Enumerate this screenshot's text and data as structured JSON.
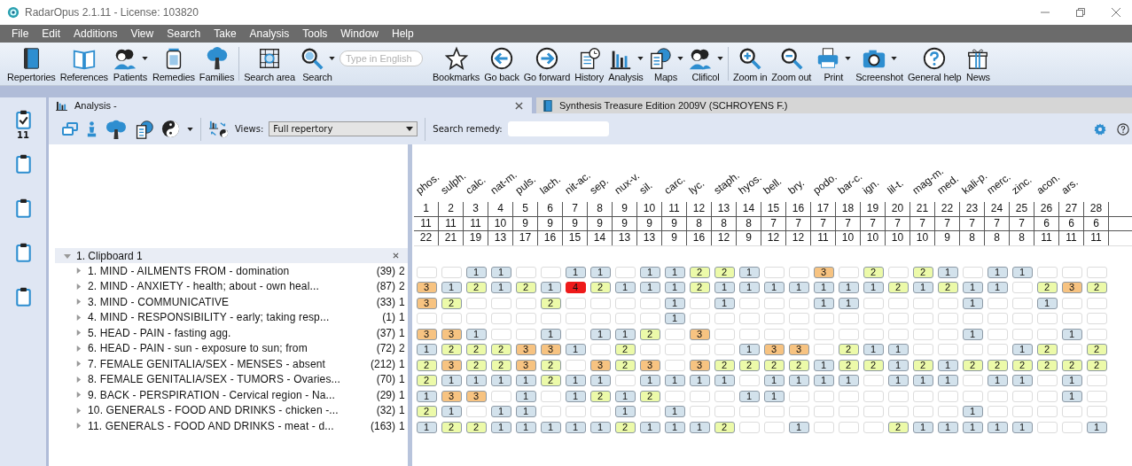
{
  "window": {
    "title": "RadarOpus 2.1.11 - License: 103820"
  },
  "menu": [
    {
      "label": "File"
    },
    {
      "label": "Edit"
    },
    {
      "label": "Additions"
    },
    {
      "label": "View"
    },
    {
      "label": "Search"
    },
    {
      "label": "Take"
    },
    {
      "label": "Analysis"
    },
    {
      "label": "Tools"
    },
    {
      "label": "Window"
    },
    {
      "label": "Help"
    }
  ],
  "toolbar": {
    "groups": [
      [
        {
          "kind": "button",
          "label": "Repertories",
          "dropdown": false
        },
        {
          "kind": "button",
          "label": "References",
          "dropdown": false
        },
        {
          "kind": "button",
          "label": "Patients",
          "dropdown": true
        },
        {
          "kind": "button",
          "label": "Remedies",
          "dropdown": false
        },
        {
          "kind": "button",
          "label": "Families",
          "dropdown": false
        }
      ],
      [
        {
          "kind": "button",
          "label": "Search area",
          "dropdown": false
        },
        {
          "kind": "button",
          "label": "Search",
          "dropdown": true
        },
        {
          "kind": "field",
          "placeholder": "Type in English"
        },
        {
          "kind": "button",
          "label": "Bookmarks",
          "dropdown": false
        },
        {
          "kind": "button",
          "label": "Go back",
          "dropdown": false
        },
        {
          "kind": "button",
          "label": "Go forward",
          "dropdown": false
        },
        {
          "kind": "button",
          "label": "History",
          "dropdown": false
        },
        {
          "kind": "button",
          "label": "Analysis",
          "dropdown": true
        },
        {
          "kind": "button",
          "label": "Maps",
          "dropdown": true
        },
        {
          "kind": "button",
          "label": "Clificol",
          "dropdown": true
        }
      ],
      [
        {
          "kind": "button",
          "label": "Zoom in",
          "dropdown": false
        },
        {
          "kind": "button",
          "label": "Zoom out",
          "dropdown": false
        },
        {
          "kind": "button",
          "label": "Print",
          "dropdown": true
        },
        {
          "kind": "button",
          "label": "Screenshot",
          "dropdown": true
        },
        {
          "kind": "button",
          "label": "General help",
          "dropdown": false
        },
        {
          "kind": "button",
          "label": "News",
          "dropdown": false
        }
      ]
    ]
  },
  "sidebar": {
    "items": [
      {
        "checked": true,
        "badge": "11"
      },
      {
        "checked": false
      },
      {
        "checked": false
      },
      {
        "checked": false
      },
      {
        "checked": false
      }
    ]
  },
  "tabs": [
    {
      "label": "Analysis -",
      "selected": true,
      "closable": true
    },
    {
      "label": "Synthesis Treasure Edition 2009V (SCHROYENS F.)",
      "selected": false,
      "closable": false
    }
  ],
  "analysis_toolbar": {
    "views_label": "Views:",
    "views_value": "Full repertory",
    "search_label": "Search remedy:"
  },
  "remedies": [
    {
      "name": "phos.",
      "rank": "1",
      "count": "11",
      "degree": "22"
    },
    {
      "name": "sulph.",
      "rank": "2",
      "count": "11",
      "degree": "21"
    },
    {
      "name": "calc.",
      "rank": "3",
      "count": "11",
      "degree": "19"
    },
    {
      "name": "nat-m.",
      "rank": "4",
      "count": "10",
      "degree": "13"
    },
    {
      "name": "puls.",
      "rank": "5",
      "count": "9",
      "degree": "17"
    },
    {
      "name": "lach.",
      "rank": "6",
      "count": "9",
      "degree": "16"
    },
    {
      "name": "nit-ac.",
      "rank": "7",
      "count": "9",
      "degree": "15"
    },
    {
      "name": "sep.",
      "rank": "8",
      "count": "9",
      "degree": "14"
    },
    {
      "name": "nux-v.",
      "rank": "9",
      "count": "9",
      "degree": "13"
    },
    {
      "name": "sil.",
      "rank": "10",
      "count": "9",
      "degree": "13"
    },
    {
      "name": "carc.",
      "rank": "11",
      "count": "9",
      "degree": "9"
    },
    {
      "name": "lyc.",
      "rank": "12",
      "count": "8",
      "degree": "16"
    },
    {
      "name": "staph.",
      "rank": "13",
      "count": "8",
      "degree": "12"
    },
    {
      "name": "hyos.",
      "rank": "14",
      "count": "8",
      "degree": "9"
    },
    {
      "name": "bell.",
      "rank": "15",
      "count": "7",
      "degree": "12"
    },
    {
      "name": "bry.",
      "rank": "16",
      "count": "7",
      "degree": "12"
    },
    {
      "name": "podo.",
      "rank": "17",
      "count": "7",
      "degree": "11"
    },
    {
      "name": "bar-c.",
      "rank": "18",
      "count": "7",
      "degree": "10"
    },
    {
      "name": "ign.",
      "rank": "19",
      "count": "7",
      "degree": "10"
    },
    {
      "name": "lil-t.",
      "rank": "20",
      "count": "7",
      "degree": "10"
    },
    {
      "name": "mag-m.",
      "rank": "21",
      "count": "7",
      "degree": "10"
    },
    {
      "name": "med.",
      "rank": "22",
      "count": "7",
      "degree": "9"
    },
    {
      "name": "kali-p.",
      "rank": "23",
      "count": "7",
      "degree": "8"
    },
    {
      "name": "merc.",
      "rank": "24",
      "count": "7",
      "degree": "8"
    },
    {
      "name": "zinc.",
      "rank": "25",
      "count": "7",
      "degree": "8"
    },
    {
      "name": "acon.",
      "rank": "26",
      "count": "6",
      "degree": "11"
    },
    {
      "name": "ars.",
      "rank": "27",
      "count": "6",
      "degree": "11"
    },
    {
      "rank": "28",
      "count": "6",
      "degree": "11"
    }
  ],
  "clipboard": {
    "label": "1. Clipboard 1",
    "expanded": true,
    "rubrics": [
      {
        "label": "1. MIND - AILMENTS FROM - domination",
        "count": "(39)",
        "weight": "2",
        "expanded": false,
        "cells": [
          null,
          null,
          "1",
          "1",
          null,
          null,
          "1",
          "1",
          null,
          "1",
          "1",
          "2",
          "2",
          "1",
          null,
          null,
          "3",
          null,
          "2",
          null,
          "2",
          "1",
          null,
          "1",
          "1",
          null,
          null,
          null
        ]
      },
      {
        "label": "2. MIND - ANXIETY - health; about - own heal...",
        "count": "(87)",
        "weight": "2",
        "expanded": false,
        "cells": [
          "3",
          "1",
          "2",
          "1",
          "2",
          "1",
          "4",
          "2",
          "1",
          "1",
          "1",
          "2",
          "1",
          "1",
          "1",
          "1",
          "1",
          "1",
          "1",
          "2",
          "1",
          "2",
          "1",
          "1",
          null,
          "2",
          "3",
          "2"
        ]
      },
      {
        "label": "3. MIND - COMMUNICATIVE",
        "count": "(33)",
        "weight": "1",
        "expanded": false,
        "cells": [
          "3",
          "2",
          null,
          null,
          null,
          "2",
          null,
          null,
          null,
          null,
          "1",
          null,
          "1",
          null,
          null,
          null,
          "1",
          "1",
          null,
          null,
          null,
          null,
          "1",
          null,
          null,
          "1",
          null,
          null
        ]
      },
      {
        "label": "4. MIND - RESPONSIBILITY - early; taking resp...",
        "count": "(1)",
        "weight": "1",
        "expanded": false,
        "cells": [
          null,
          null,
          null,
          null,
          null,
          null,
          null,
          null,
          null,
          null,
          "1",
          null,
          null,
          null,
          null,
          null,
          null,
          null,
          null,
          null,
          null,
          null,
          null,
          null,
          null,
          null,
          null,
          null
        ]
      },
      {
        "label": "5. HEAD - PAIN - fasting agg.",
        "count": "(37)",
        "weight": "1",
        "expanded": false,
        "cells": [
          "3",
          "3",
          "1",
          null,
          null,
          "1",
          null,
          "1",
          "1",
          "2",
          null,
          "3",
          null,
          null,
          null,
          null,
          null,
          null,
          null,
          null,
          null,
          null,
          "1",
          null,
          null,
          null,
          "1",
          null
        ]
      },
      {
        "label": "6. HEAD - PAIN - sun - exposure to sun; from",
        "count": "(72)",
        "weight": "2",
        "expanded": false,
        "cells": [
          "1",
          "2",
          "2",
          "2",
          "3",
          "3",
          "1",
          null,
          "2",
          null,
          null,
          null,
          null,
          "1",
          "3",
          "3",
          null,
          "2",
          "1",
          "1",
          null,
          null,
          null,
          null,
          "1",
          "2",
          null,
          "2"
        ]
      },
      {
        "label": "7. FEMALE GENITALIA/SEX - MENSES - absent",
        "count": "(212)",
        "weight": "1",
        "expanded": false,
        "cells": [
          "2",
          "3",
          "2",
          "2",
          "3",
          "2",
          null,
          "3",
          "2",
          "3",
          null,
          "3",
          "2",
          "2",
          "2",
          "2",
          "1",
          "2",
          "2",
          "1",
          "2",
          "1",
          "2",
          "2",
          "2",
          "2",
          "2",
          "2"
        ]
      },
      {
        "label": "8. FEMALE GENITALIA/SEX - TUMORS - Ovaries...",
        "count": "(70)",
        "weight": "1",
        "expanded": false,
        "cells": [
          "2",
          "1",
          "1",
          "1",
          "1",
          "2",
          "1",
          "1",
          null,
          "1",
          "1",
          "1",
          "1",
          null,
          "1",
          "1",
          "1",
          "1",
          null,
          "1",
          "1",
          "1",
          null,
          "1",
          "1",
          null,
          "1",
          null
        ]
      },
      {
        "label": "9. BACK - PERSPIRATION - Cervical region - Na...",
        "count": "(29)",
        "weight": "1",
        "expanded": false,
        "cells": [
          "1",
          "3",
          "3",
          null,
          "1",
          null,
          "1",
          "2",
          "1",
          "2",
          null,
          null,
          null,
          "1",
          "1",
          null,
          null,
          null,
          null,
          null,
          null,
          null,
          null,
          null,
          null,
          null,
          "1",
          null
        ]
      },
      {
        "label": "10. GENERALS - FOOD AND DRINKS - chicken -...",
        "count": "(32)",
        "weight": "1",
        "expanded": false,
        "cells": [
          "2",
          "1",
          null,
          "1",
          "1",
          null,
          null,
          null,
          "1",
          null,
          "1",
          null,
          null,
          null,
          null,
          null,
          null,
          null,
          null,
          null,
          null,
          null,
          "1",
          null,
          null,
          null,
          null,
          null
        ]
      },
      {
        "label": "11. GENERALS - FOOD AND DRINKS - meat - d...",
        "count": "(163)",
        "weight": "1",
        "expanded": false,
        "cells": [
          "1",
          "2",
          "2",
          "1",
          "1",
          "1",
          "1",
          "1",
          "2",
          "1",
          "1",
          "1",
          "2",
          null,
          null,
          "1",
          null,
          null,
          null,
          "2",
          "1",
          "1",
          "1",
          "1",
          "1",
          null,
          null,
          "1"
        ]
      }
    ]
  }
}
